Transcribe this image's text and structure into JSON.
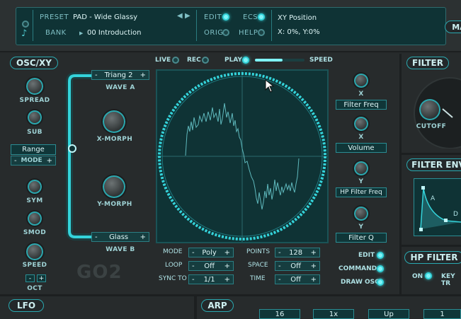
{
  "header": {
    "preset_label": "PRESET",
    "preset_value": "PAD - Wide Glassy",
    "bank_label": "BANK",
    "bank_value": "00 Introduction",
    "edit_label": "EDIT",
    "orig_label": "ORIG",
    "ecs_label": "ECS",
    "help_label": "HELP",
    "info_title": "XY Position",
    "info_value": "X: 0%, Y:0%",
    "prev_glyph": "◀",
    "next_glyph": "▶",
    "mac_label": "MA"
  },
  "osc": {
    "title": "OSC/XY",
    "spread": "SPREAD",
    "sub": "SUB",
    "range": "Range",
    "mode": "MODE",
    "sym": "SYM",
    "smod": "SMOD",
    "speed": "SPEED",
    "oct": "OCT",
    "minus": "-",
    "plus": "+",
    "wave_a_value": "Triang 2",
    "wave_a": "WAVE A",
    "wave_b_value": "Glass",
    "wave_b": "WAVE B",
    "xmorph": "X-MORPH",
    "ymorph": "Y-MORPH",
    "logo": "GO2"
  },
  "xy": {
    "live": "LIVE",
    "rec": "REC",
    "play": "PLAY",
    "speed": "SPEED",
    "playback_speed": 0.55,
    "mode_label": "MODE",
    "mode_value": "Poly",
    "points_label": "POINTS",
    "points_value": "128",
    "loop_label": "LOOP",
    "loop_value": "Off",
    "space_label": "SPACE",
    "space_value": "Off",
    "sync_label": "SYNC TO",
    "sync_value": "1/1",
    "time_label": "TIME",
    "time_value": "Off"
  },
  "targets": {
    "x": "X",
    "y": "Y",
    "x1_target": "Filter Freq",
    "x2_target": "Volume",
    "y1_target": "HP Filter Freq",
    "y2_target": "Filter Q",
    "edit": "EDIT",
    "command": "COMMAND",
    "draw_osc": "DRAW OSC"
  },
  "filter": {
    "title": "FILTER",
    "cutoff": "CUTOFF"
  },
  "filter_env": {
    "title": "FILTER ENV",
    "a": "A",
    "d": "D"
  },
  "hp_filter": {
    "title": "HP FILTER",
    "on": "ON",
    "keytrack": "KEY TR"
  },
  "lfo": {
    "title": "LFO"
  },
  "arp": {
    "title": "ARP",
    "values": [
      "16",
      "1x",
      "Up",
      "1"
    ]
  },
  "colors": {
    "accent": "#2aa9b0",
    "glow": "#34d3da",
    "bg": "#262a2b",
    "display": "#0f3335"
  }
}
